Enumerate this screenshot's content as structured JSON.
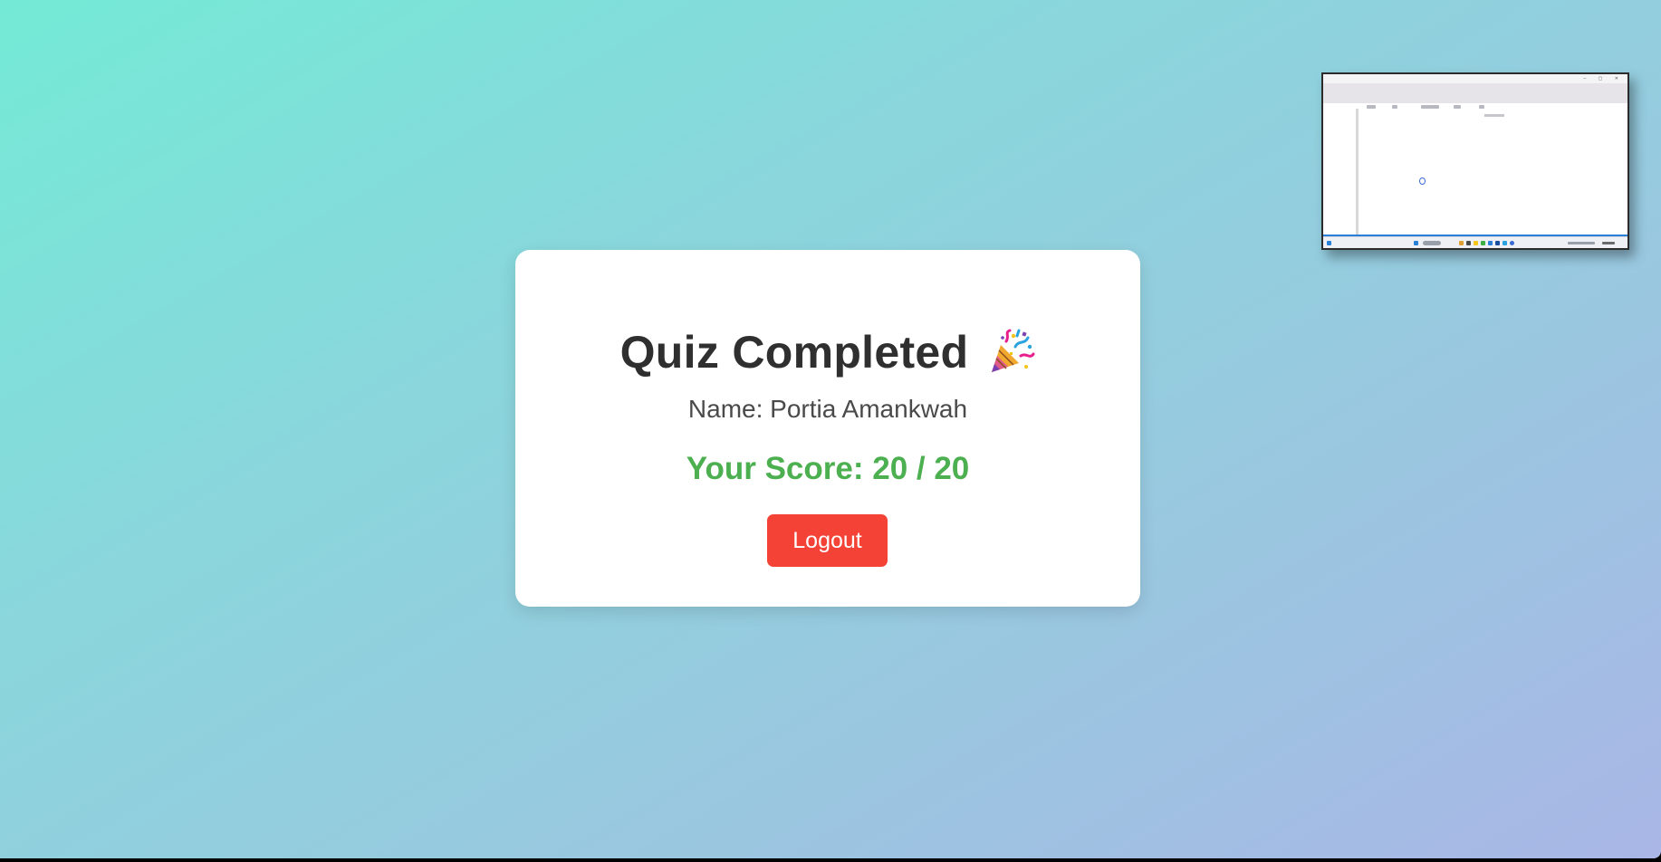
{
  "quiz_result": {
    "title": "Quiz Completed",
    "celebration_icon": "party-popper-icon",
    "name_line": "Name: Portia Amankwah",
    "score_line": "Your Score: 20 / 20",
    "logout_label": "Logout"
  },
  "colors": {
    "background_gradient_start": "#74ead6",
    "background_gradient_end": "#a9b6e6",
    "card": "#ffffff",
    "title_text": "#2f2f2f",
    "name_text": "#4a4a4a",
    "score_text": "#4caf50",
    "logout_button": "#f44336"
  },
  "thumbnail": {
    "icon": "screen-preview-thumbnail"
  }
}
